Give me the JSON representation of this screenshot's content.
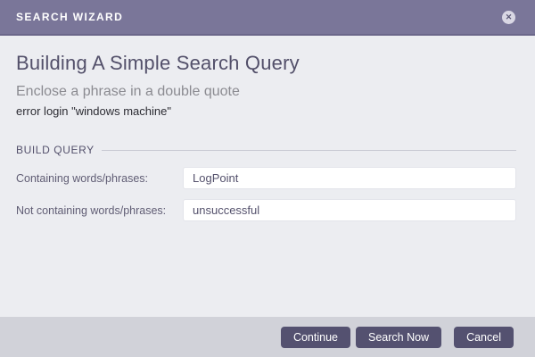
{
  "dialog": {
    "header": {
      "title": "SEARCH WIZARD",
      "close_glyph": "✕"
    },
    "content": {
      "heading": "Building A Simple Search Query",
      "subtitle": "Enclose a phrase in a double quote",
      "example": "error login  \"windows machine\"",
      "section_label": "BUILD QUERY",
      "fields": [
        {
          "label": "Containing words/phrases:",
          "value": "LogPoint"
        },
        {
          "label": "Not containing words/phrases:",
          "value": "unsuccessful"
        }
      ]
    },
    "footer": {
      "buttons": {
        "continue": "Continue",
        "search_now": "Search Now",
        "cancel": "Cancel"
      }
    }
  },
  "colors": {
    "header_background": "#7a7699",
    "header_border": "#6b678a",
    "body_background": "#ecedf1",
    "footer_background": "#d1d2d9",
    "button_background": "#545170",
    "heading_text": "#53506a",
    "subtitle_text": "#8b8b91",
    "input_background": "#ffffff"
  }
}
